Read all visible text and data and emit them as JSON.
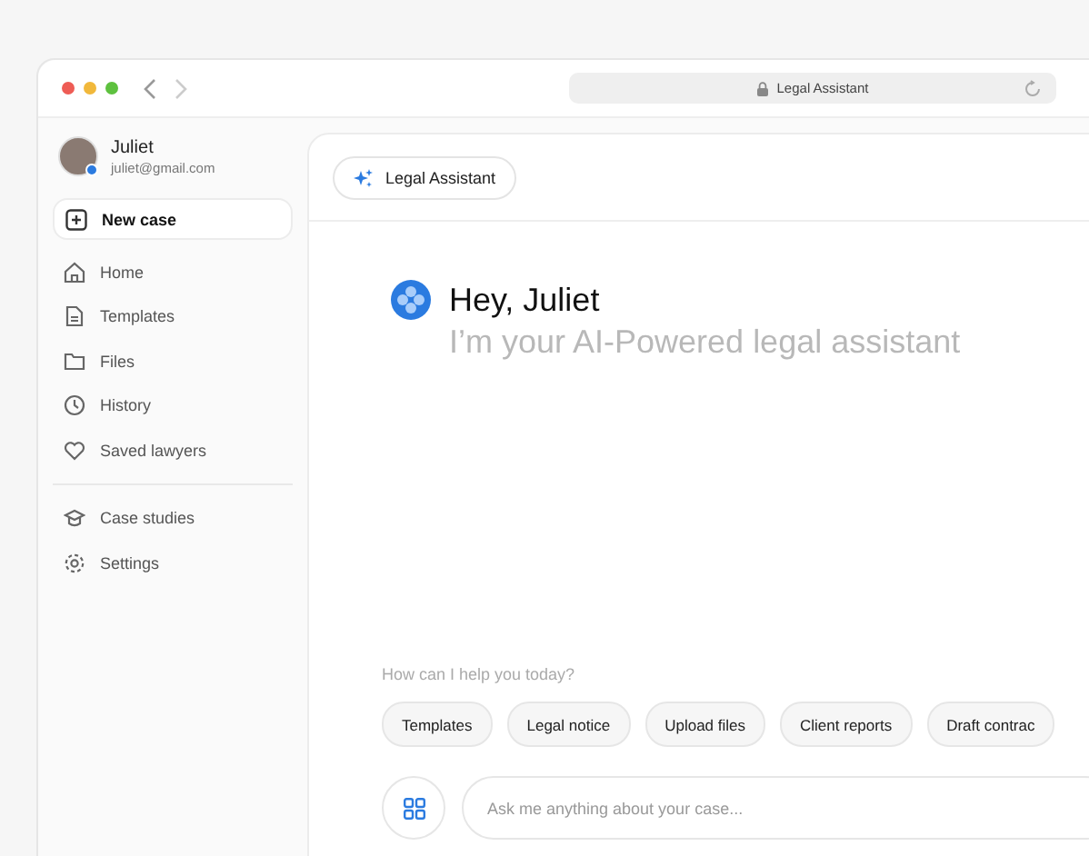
{
  "browser": {
    "address": "Legal Assistant"
  },
  "user": {
    "name": "Juliet",
    "email": "juliet@gmail.com",
    "online": true
  },
  "sidebar": {
    "items": [
      {
        "kind": "new",
        "label": "New case",
        "selected": true
      },
      {
        "kind": "home",
        "label": "Home",
        "selected": false
      },
      {
        "kind": "templates",
        "label": "Templates",
        "selected": false
      },
      {
        "kind": "files",
        "label": "Files",
        "selected": false
      },
      {
        "kind": "history",
        "label": "History",
        "selected": false
      },
      {
        "kind": "saved",
        "label": "Saved lawyers",
        "selected": false
      }
    ],
    "footer_items": [
      {
        "kind": "studies",
        "label": "Case studies"
      },
      {
        "kind": "settings",
        "label": "Settings"
      }
    ]
  },
  "header": {
    "chip": "Legal Assistant"
  },
  "greeting": {
    "title": "Hey, Juliet",
    "subtitle": "I’m your AI-Powered legal assistant"
  },
  "prompt": {
    "question": "How can I help you today?",
    "suggestions": [
      "Templates",
      "Legal notice",
      "Upload files",
      "Client reports",
      "Draft contrac"
    ],
    "placeholder": "Ask me anything about your case..."
  }
}
